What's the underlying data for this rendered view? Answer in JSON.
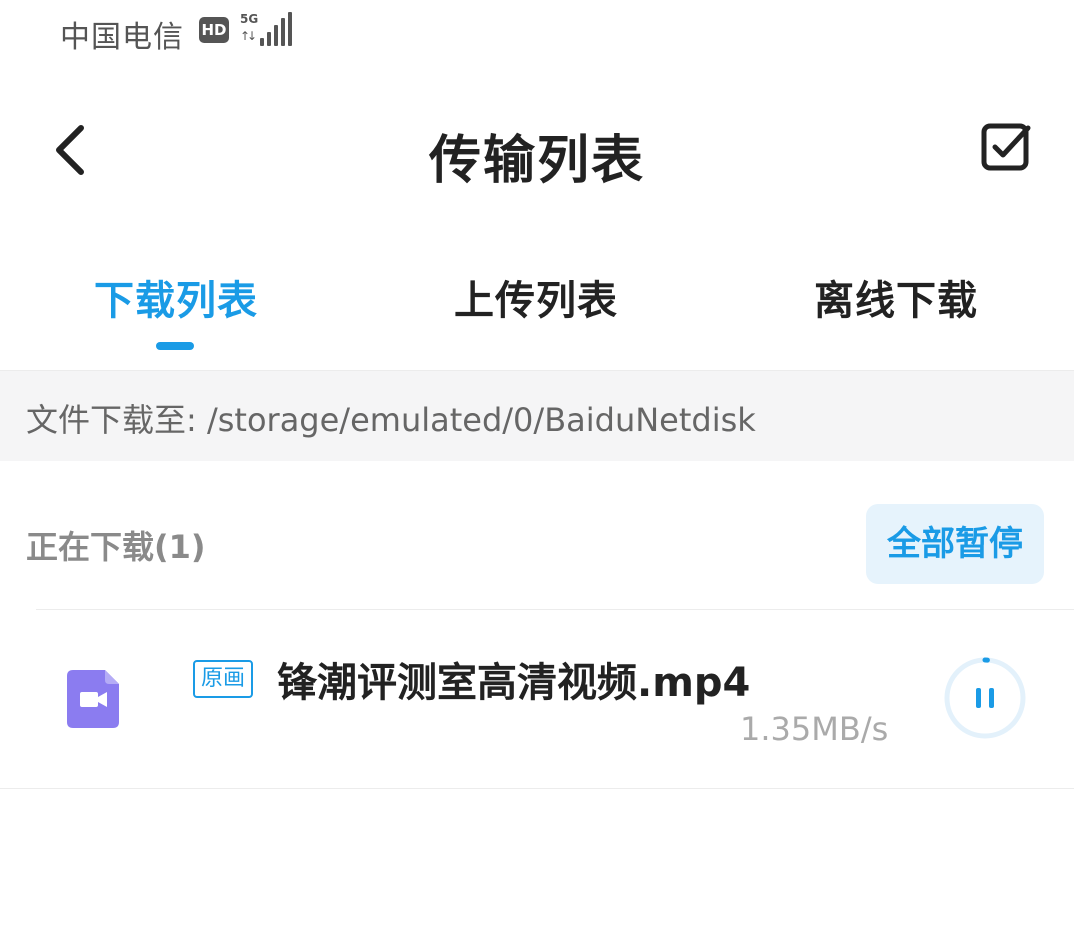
{
  "status_bar": {
    "carrier": "中国电信",
    "hd_badge": "HD",
    "network_type": "5G",
    "data_arrows": "↑↓"
  },
  "header": {
    "back_icon": "chevron-left-icon",
    "title": "传输列表",
    "select_icon": "checkbox-check-icon"
  },
  "tabs": [
    {
      "label": "下载列表",
      "active": true
    },
    {
      "label": "上传列表",
      "active": false
    },
    {
      "label": "离线下载",
      "active": false
    }
  ],
  "download_path": "文件下载至: /storage/emulated/0/BaiduNetdisk",
  "section": {
    "title": "正在下载(1)",
    "pause_all_label": "全部暂停"
  },
  "downloads": [
    {
      "icon": "video-file-icon",
      "quality_tag": "原画",
      "name": "锋潮评测室高清视频.mp4",
      "speed": "1.35MB/s",
      "progress": 0.01
    }
  ],
  "colors": {
    "accent": "#1a9be6",
    "video_icon": "#8b7cf0",
    "text_primary": "#222222",
    "text_secondary": "#8a8a8a"
  }
}
